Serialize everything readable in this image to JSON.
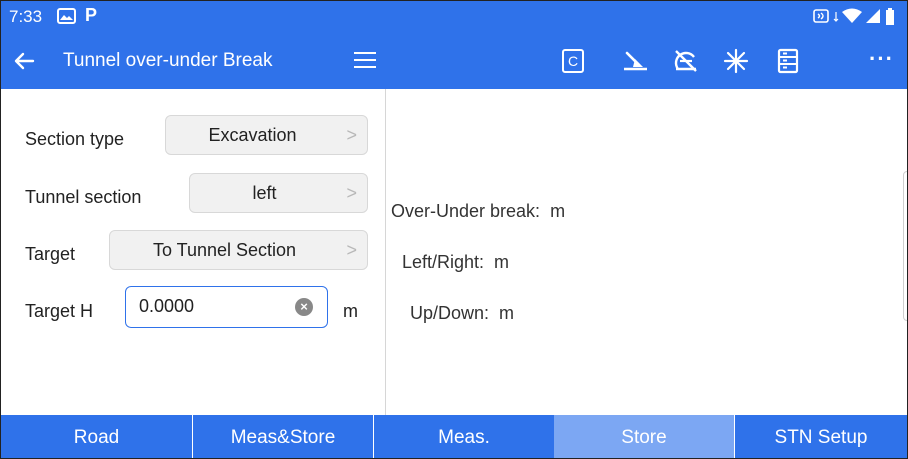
{
  "status_bar": {
    "time": "7:33",
    "left_icons": [
      "photo-icon",
      "p-icon"
    ],
    "p_glyph": "P",
    "right_icons": [
      "nfc-icon",
      "data-arrows-icon",
      "wifi-icon",
      "signal-icon",
      "battery-icon"
    ]
  },
  "app_bar": {
    "title": "Tunnel over-under Break",
    "c_label": "C",
    "more_glyph": "···",
    "icons": [
      "back-arrow-icon",
      "menu-icon",
      "c-button",
      "ground-line-icon",
      "no-prism-icon",
      "laser-icon",
      "list-icon",
      "more-icon"
    ]
  },
  "form": {
    "section_type": {
      "label": "Section type",
      "value": "Excavation"
    },
    "tunnel_section": {
      "label": "Tunnel section",
      "value": "left"
    },
    "target": {
      "label": "Target",
      "value": "To Tunnel Section"
    },
    "target_h": {
      "label": "Target H",
      "value": "0.0000",
      "unit": "m"
    },
    "chevron": ">"
  },
  "results": {
    "over_under": {
      "label": "Over-Under break:",
      "unit": "m"
    },
    "left_right": {
      "label": "Left/Right:",
      "unit": "m"
    },
    "up_down": {
      "label": "Up/Down:",
      "unit": "m"
    }
  },
  "tabs": [
    {
      "label": "Road",
      "active": false
    },
    {
      "label": "Meas&Store",
      "active": false
    },
    {
      "label": "Meas.",
      "active": false
    },
    {
      "label": "Store",
      "active": true
    },
    {
      "label": "STN Setup",
      "active": false
    }
  ],
  "colors": {
    "primary": "#2f72ea",
    "active_tab": "#7ca7f3",
    "input_border": "#2f72ea"
  }
}
